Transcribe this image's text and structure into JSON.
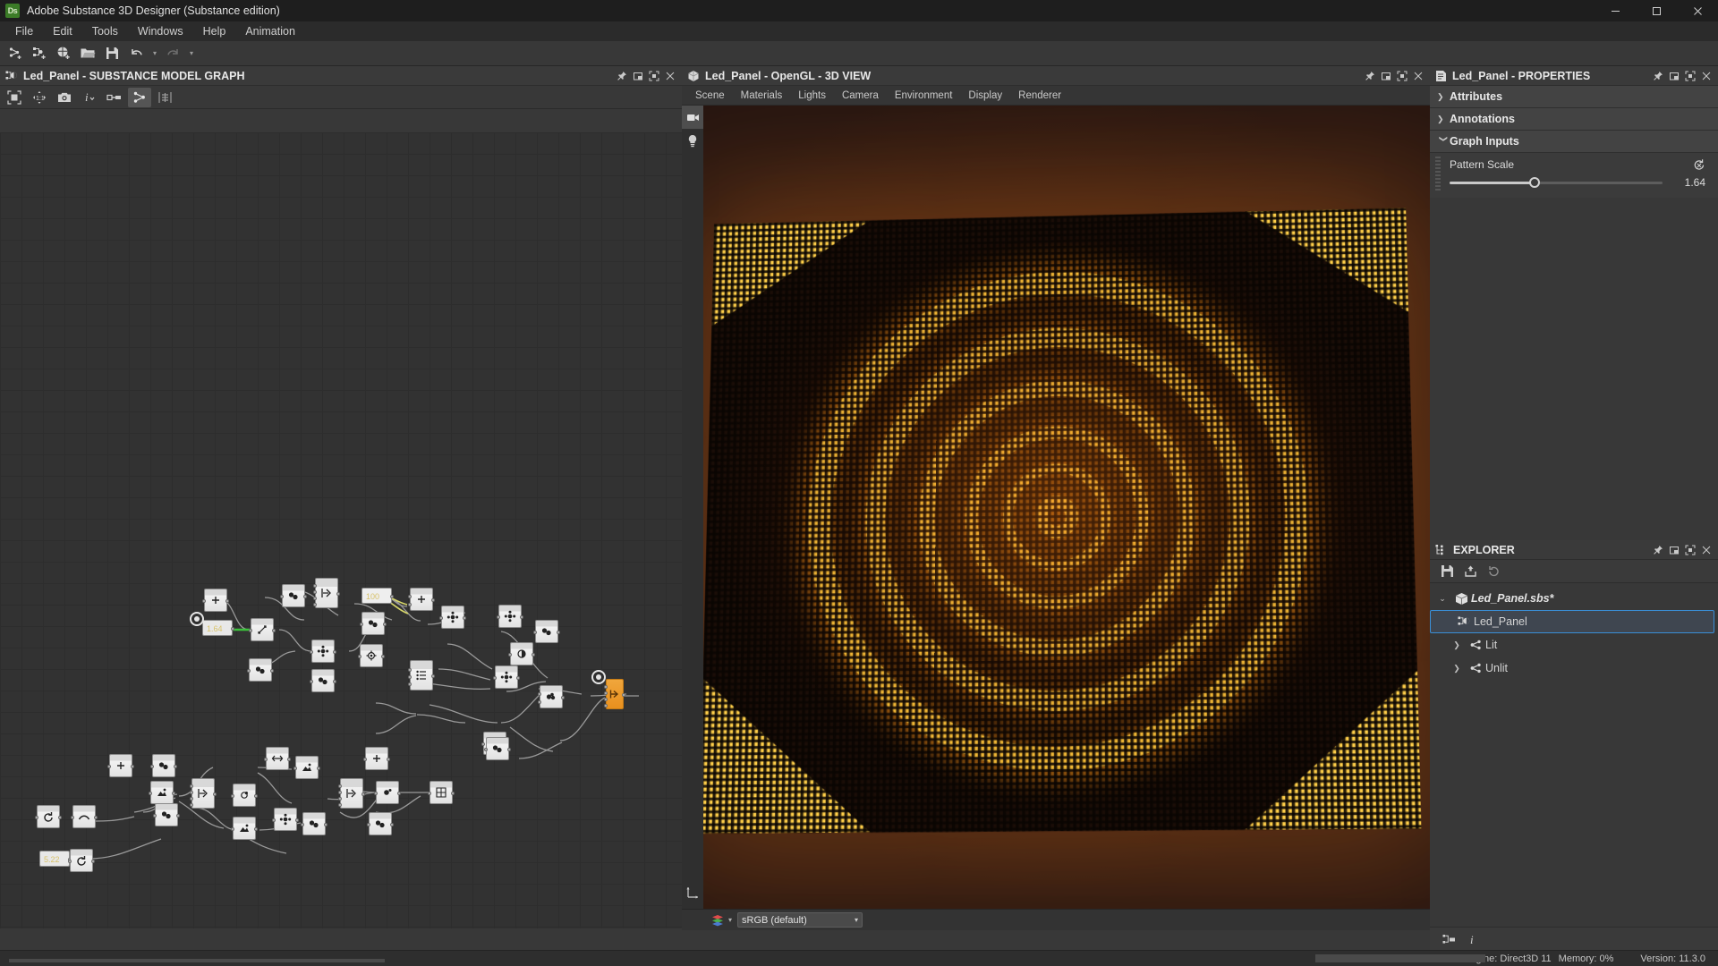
{
  "window": {
    "title": "Adobe Substance 3D Designer (Substance edition)",
    "logo_text": "Ds",
    "minimize": "–",
    "maximize": "❐",
    "close": "✕"
  },
  "menubar": {
    "items": [
      "File",
      "Edit",
      "Tools",
      "Windows",
      "Help",
      "Animation"
    ]
  },
  "main_toolbar": {
    "buttons": [
      {
        "name": "new-substance-graph-icon",
        "label": "New Substance Graph"
      },
      {
        "name": "new-model-graph-icon",
        "label": "New Model Graph"
      },
      {
        "name": "new-package-icon",
        "label": "New Package"
      },
      {
        "name": "open-package-icon",
        "label": "Open Package"
      },
      {
        "name": "save-package-icon",
        "label": "Save Package"
      },
      {
        "name": "undo-icon",
        "label": "Undo"
      },
      {
        "name": "redo-icon",
        "label": "Redo"
      }
    ]
  },
  "graph_panel": {
    "title": "Led_Panel - SUBSTANCE MODEL GRAPH",
    "icon": "model-graph-icon",
    "head_buttons": [
      "pin-icon",
      "restore-icon",
      "maximize-icon",
      "close-icon"
    ],
    "toolbar": [
      {
        "name": "frame-all-icon",
        "active": false
      },
      {
        "name": "zoom-one-to-one-icon",
        "active": false
      },
      {
        "name": "snapshot-icon",
        "active": false
      },
      {
        "name": "info-icon",
        "active": false
      },
      {
        "name": "show-connections-icon",
        "active": false
      },
      {
        "name": "graph-layout-icon",
        "active": true
      },
      {
        "name": "align-nodes-icon",
        "active": false
      }
    ],
    "node_labels": {
      "pattern_scale_value": "1.64",
      "hundred_value": "100",
      "lower_value": "5.22"
    }
  },
  "view3d_panel": {
    "title": "Led_Panel - OpenGL - 3D VIEW",
    "icon": "cube-icon",
    "head_buttons": [
      "pin-icon",
      "restore-icon",
      "maximize-icon",
      "close-icon"
    ],
    "menus": [
      "Scene",
      "Materials",
      "Lights",
      "Camera",
      "Environment",
      "Display",
      "Renderer"
    ],
    "side_tools": [
      {
        "name": "camera-tool-icon",
        "active": true
      },
      {
        "name": "light-tool-icon",
        "active": false
      },
      {
        "name": "axis-gizmo-icon",
        "active": false
      }
    ],
    "colorspace": {
      "icon": "color-layers-icon",
      "value": "sRGB (default)",
      "chevron": "▾"
    }
  },
  "properties_panel": {
    "title": "Led_Panel - PROPERTIES",
    "icon": "properties-doc-icon",
    "head_buttons": [
      "pin-icon",
      "restore-icon",
      "maximize-icon",
      "close-icon"
    ],
    "sections": [
      {
        "label": "Attributes",
        "expanded": false,
        "chevron": "❯"
      },
      {
        "label": "Annotations",
        "expanded": false,
        "chevron": "❯"
      },
      {
        "label": "Graph Inputs",
        "expanded": true,
        "chevron": "❯"
      }
    ],
    "graph_inputs": [
      {
        "label": "Pattern Scale",
        "value": "1.64",
        "reset_icon": "reset-icon",
        "slider_percent": 40
      }
    ]
  },
  "explorer_panel": {
    "title": "EXPLORER",
    "icon": "explorer-tree-icon",
    "head_buttons": [
      "pin-icon",
      "restore-icon",
      "maximize-icon",
      "close-icon"
    ],
    "toolbar": [
      {
        "name": "save-icon"
      },
      {
        "name": "export-icon"
      },
      {
        "name": "refresh-icon"
      }
    ],
    "tree": [
      {
        "label": "Led_Panel.sbs*",
        "type": "package",
        "icon": "package-icon",
        "chevron": "⌄",
        "depth": 0,
        "selected": false
      },
      {
        "label": "Led_Panel",
        "type": "model-graph",
        "icon": "model-graph-icon",
        "chevron": "",
        "depth": 1,
        "selected": true
      },
      {
        "label": "Lit",
        "type": "graph",
        "icon": "graph-icon",
        "chevron": "❯",
        "depth": 1,
        "selected": false
      },
      {
        "label": "Unlit",
        "type": "graph",
        "icon": "graph-icon",
        "chevron": "❯",
        "depth": 1,
        "selected": false
      }
    ],
    "bottom_buttons": [
      {
        "name": "dependencies-icon"
      },
      {
        "name": "info-icon"
      }
    ]
  },
  "statusbar": {
    "engine": "Substance Engine: Direct3D 11",
    "memory": "Memory: 0%",
    "version": "Version: 11.3.0"
  },
  "colors": {
    "accent_orange": "#f0a63c",
    "selection_blue": "#3a8fd8",
    "panel_bg": "#383838",
    "header_bg": "#3a3a3a",
    "canvas_bg": "#323232",
    "led_glow": "#ffc53a"
  }
}
